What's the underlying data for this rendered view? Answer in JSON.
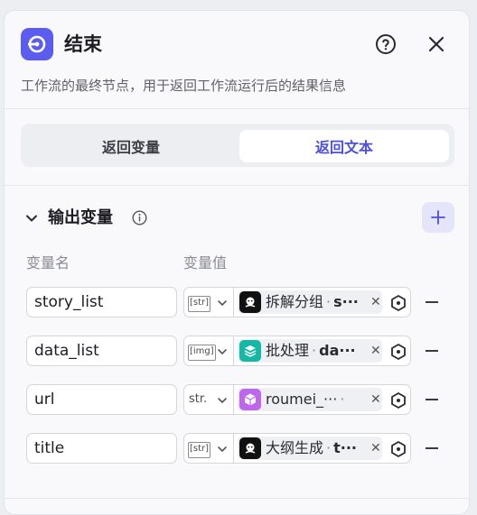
{
  "node": {
    "title": "结束",
    "description": "工作流的最终节点，用于返回工作流运行后的结果信息"
  },
  "tabs": [
    {
      "label": "返回变量",
      "active": false
    },
    {
      "label": "返回文本",
      "active": true
    }
  ],
  "output_section": {
    "title": "输出变量",
    "col_name": "变量名",
    "col_value": "变量值"
  },
  "rows": [
    {
      "name": "story_list",
      "type": "[str]",
      "source": "拆解分组",
      "var": "s···",
      "icon": "agent-icon",
      "icon_color": "#111111"
    },
    {
      "name": "data_list",
      "type": "[img]",
      "source": "批处理",
      "var": "da···",
      "icon": "batch-icon",
      "icon_color": "#14b8a6"
    },
    {
      "name": "url",
      "type": "str.",
      "source": "roumei_···",
      "var": "",
      "icon": "cube-icon",
      "icon_color": "#c065f0"
    },
    {
      "name": "title",
      "type": "[str]",
      "source": "大纲生成",
      "var": "t···",
      "icon": "agent-icon",
      "icon_color": "#111111"
    }
  ],
  "colors": {
    "accent": "#5a5df0",
    "active_tab_text": "#4c4fe0"
  }
}
